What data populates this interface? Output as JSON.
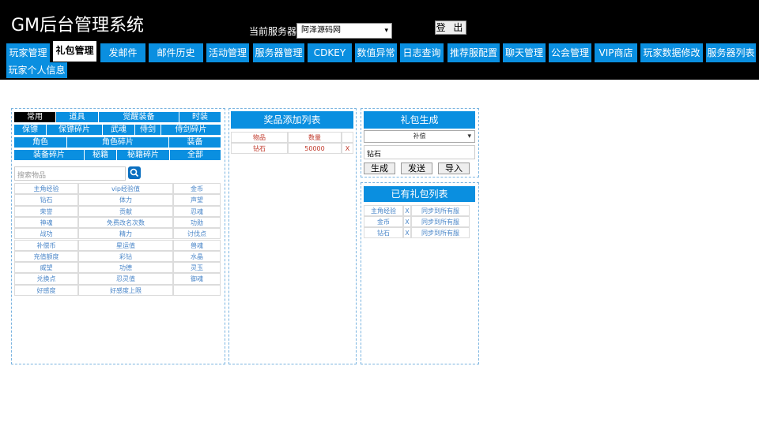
{
  "app": {
    "title": "GM后台管理系统",
    "server_label": "当前服务器:",
    "server_value": "阿泽源码网",
    "login_label": "登 出"
  },
  "tabs": [
    "玩家管理",
    "礼包管理",
    "发邮件",
    "邮件历史",
    "活动管理",
    "服务器管理",
    "CDKEY",
    "数值异常",
    "日志查询",
    "推荐服配置",
    "聊天管理",
    "公会管理",
    "VIP商店",
    "玩家数据修改",
    "服务器列表",
    "玩家个人信息"
  ],
  "active_tab": "礼包管理",
  "left_panel": {
    "categories_row1": [
      "常用",
      "道具",
      "觉醒装备",
      "时装"
    ],
    "categories_row2": [
      "保镖",
      "保镖碎片",
      "武魂",
      "侍剑",
      "侍剑碎片"
    ],
    "categories_row3": [
      "角色",
      "角色碎片",
      "装备"
    ],
    "categories_row4": [
      "装备碎片",
      "秘籍",
      "秘籍碎片",
      "全部"
    ],
    "search_placeholder": "搜索物品",
    "items": [
      [
        "主角经验",
        "vip经验值",
        "金币"
      ],
      [
        "钻石",
        "体力",
        "声望"
      ],
      [
        "荣誉",
        "贡献",
        "忍魂"
      ],
      [
        "神魂",
        "免费改名次数",
        "功勋"
      ],
      [
        "战功",
        "精力",
        "讨伐点"
      ],
      [
        "补偿币",
        "星运值",
        "兽魂"
      ],
      [
        "充值额度",
        "彩钻",
        "水晶"
      ],
      [
        "威望",
        "功德",
        "灵玉"
      ],
      [
        "兑换点",
        "忍灵值",
        "御魂"
      ],
      [
        "好感度",
        "好感度上限",
        ""
      ]
    ]
  },
  "middle_panel": {
    "title": "奖品添加列表",
    "headers": [
      "物品",
      "数量"
    ],
    "rows": [
      {
        "item": "钻石",
        "qty": "50000",
        "remove": "X"
      }
    ]
  },
  "gift_gen": {
    "title": "礼包生成",
    "select_value": "补偿",
    "input_value": "钻石",
    "buttons": [
      "生成",
      "发送",
      "导入"
    ]
  },
  "gift_list": {
    "title": "已有礼包列表",
    "rows": [
      {
        "name": "主角经验",
        "remove": "X",
        "sync": "同步到所有服"
      },
      {
        "name": "金币",
        "remove": "X",
        "sync": "同步到所有服"
      },
      {
        "name": "钻石",
        "remove": "X",
        "sync": "同步到所有服"
      }
    ]
  },
  "colors": {
    "accent": "#0a8fe0",
    "header": "#000000",
    "dashed_border": "#7ab4e0",
    "link": "#4a86c8"
  }
}
